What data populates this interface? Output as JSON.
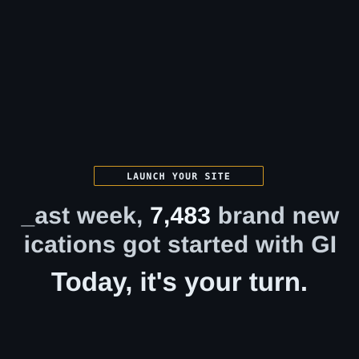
{
  "badge": {
    "label": "LAUNCH YOUR SITE"
  },
  "headline": {
    "line1_before": "_ast week, ",
    "line1_count": "7,483",
    "line1_after": " brand new",
    "line2": "ications got started with GI"
  },
  "cta": {
    "text": "Today, it's your turn."
  },
  "colors": {
    "background": "#0d1117",
    "badge_border": "#d29922",
    "text_primary": "#e6edf3",
    "text_secondary": "#c9d1d9"
  }
}
